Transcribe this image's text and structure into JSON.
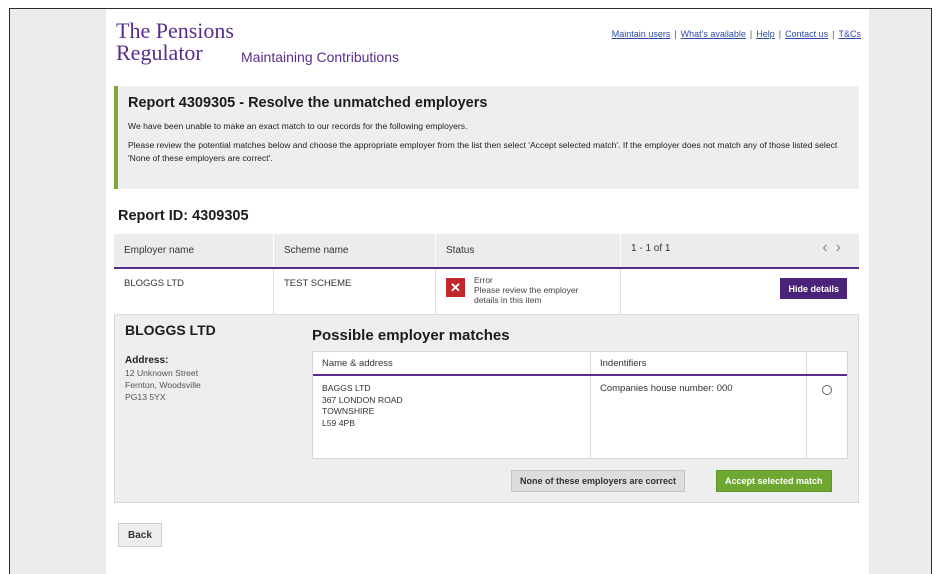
{
  "header": {
    "logo_line1": "The Pensions",
    "logo_line2": "Regulator",
    "app_title": "Maintaining Contributions",
    "nav": [
      {
        "label": "Maintain users"
      },
      {
        "label": "What's available"
      },
      {
        "label": "Help"
      },
      {
        "label": "Contact us"
      },
      {
        "label": "T&Cs"
      }
    ],
    "nav_separator": "|"
  },
  "notice": {
    "title": "Report 4309305 - Resolve the unmatched employers",
    "para1": "We have been unable to make an exact match to our records for the following employers.",
    "para2": "Please review the potential matches below and choose the appropriate employer from the list then select 'Accept selected match'. If the employer does not match any of those listed select 'None of these employers are correct'."
  },
  "report_id": "Report ID: 4309305",
  "results": {
    "columns": [
      "Employer name",
      "Scheme name",
      "Status"
    ],
    "pagination": "1 - 1 of 1",
    "prev_icon": "‹",
    "next_icon": "›",
    "row": {
      "employer": "BLOGGS LTD",
      "scheme": "TEST SCHEME",
      "status_icon": "✕",
      "status_title": "Error",
      "status_line1": "Please review the employer",
      "status_line2": "details in this item",
      "hide_label": "Hide details"
    }
  },
  "detail": {
    "employer_name": "BLOGGS LTD",
    "address_label": "Address:",
    "address_lines": [
      "12 Unknown Street",
      "Fernton, Woodsville",
      "PG13 5YX"
    ],
    "matches_title": "Possible employer matches",
    "match_columns": [
      "Name & address",
      "Indentifiers",
      ""
    ],
    "match": {
      "lines": [
        "BAGGS LTD",
        "367 LONDON ROAD",
        "TOWNSHIRE",
        "L59 4PB"
      ],
      "identifier": "Companies house number:  000"
    },
    "none_label": "None of these employers are correct",
    "accept_label": "Accept selected match"
  },
  "back_label": "Back",
  "colors": {
    "brand": "#5a2d8c",
    "error": "#c0282d",
    "accept": "#6ea832",
    "notice_border": "#7aa83b"
  }
}
